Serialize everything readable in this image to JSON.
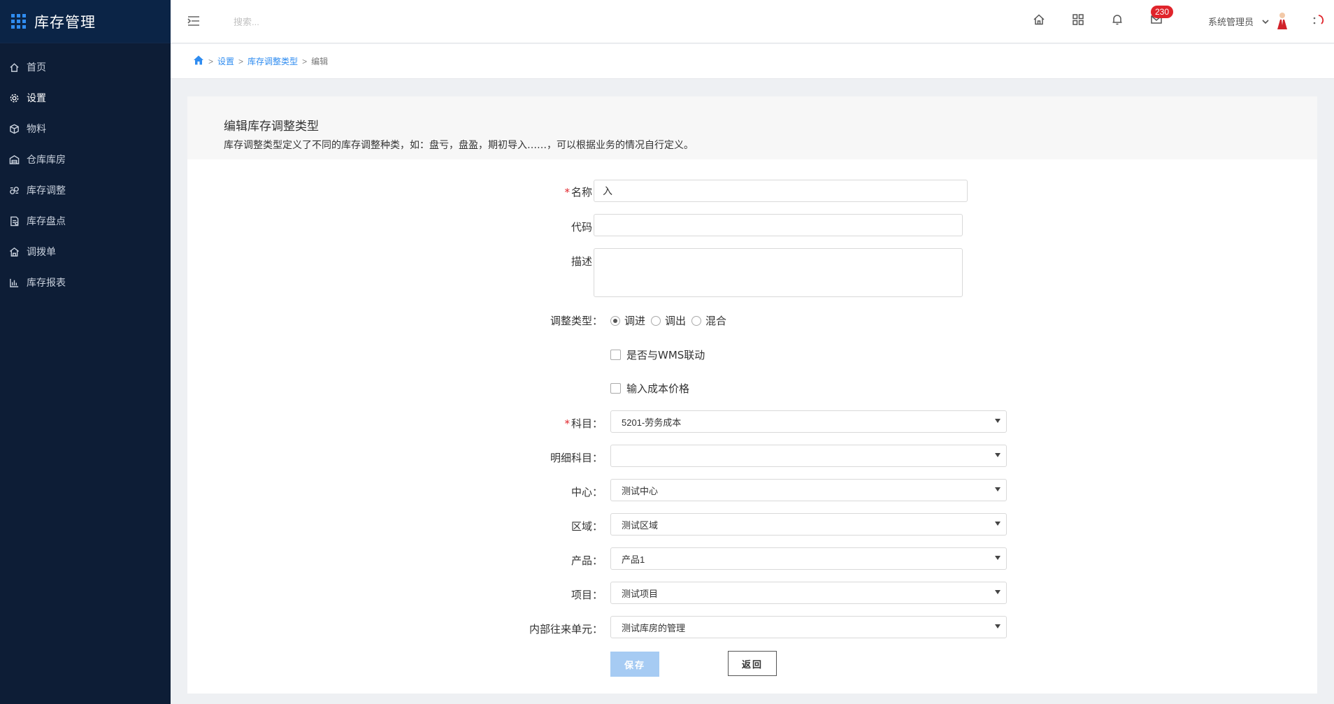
{
  "app": {
    "title": "库存管理"
  },
  "sidebar": {
    "items": [
      {
        "label": "首页",
        "icon": "home-icon"
      },
      {
        "label": "设置",
        "icon": "gear-icon"
      },
      {
        "label": "物料",
        "icon": "cube-icon"
      },
      {
        "label": "仓库库房",
        "icon": "warehouse-icon"
      },
      {
        "label": "库存调整",
        "icon": "adjust-icon"
      },
      {
        "label": "库存盘点",
        "icon": "inventory-check-icon"
      },
      {
        "label": "调拨单",
        "icon": "transfer-icon"
      },
      {
        "label": "库存报表",
        "icon": "bar-chart-icon"
      }
    ],
    "active_index": 1
  },
  "header": {
    "search_placeholder": "搜索...",
    "badge_count": "230",
    "user_name": "系统管理员"
  },
  "breadcrumb": {
    "items": [
      "设置",
      "库存调整类型"
    ],
    "current": "编辑"
  },
  "card": {
    "title": "编辑库存调整类型",
    "description": "库存调整类型定义了不同的库存调整种类，如：盘亏，盘盈，期初导入……，可以根据业务的情况自行定义。"
  },
  "form": {
    "name_label": "名称：",
    "name_value": "入",
    "code_label": "代码：",
    "code_value": "",
    "desc_label": "描述：",
    "adjust_type_label": "调整类型：",
    "adjust_options": [
      "调进",
      "调出",
      "混合"
    ],
    "adjust_selected": 0,
    "wms_link_label": "是否与WMS联动",
    "cost_price_label": "输入成本价格",
    "account_label": "科目：",
    "account_value": "5201-劳务成本",
    "detail_account_label": "明细科目：",
    "detail_account_value": "",
    "center_label": "中心：",
    "center_value": "测试中心",
    "region_label": "区域：",
    "region_value": "测试区域",
    "product_label": "产品：",
    "product_value": "产品1",
    "project_label": "项目：",
    "project_value": "测试项目",
    "internal_unit_label": "内部往来单元：",
    "internal_unit_value": "测试库房的管理",
    "save_label": "保存",
    "back_label": "返回"
  },
  "colors": {
    "sidebar_bg": "#0d1d36",
    "accent": "#2f8cf0",
    "badge": "#e0242b",
    "save_button": "#a6cbf3"
  }
}
